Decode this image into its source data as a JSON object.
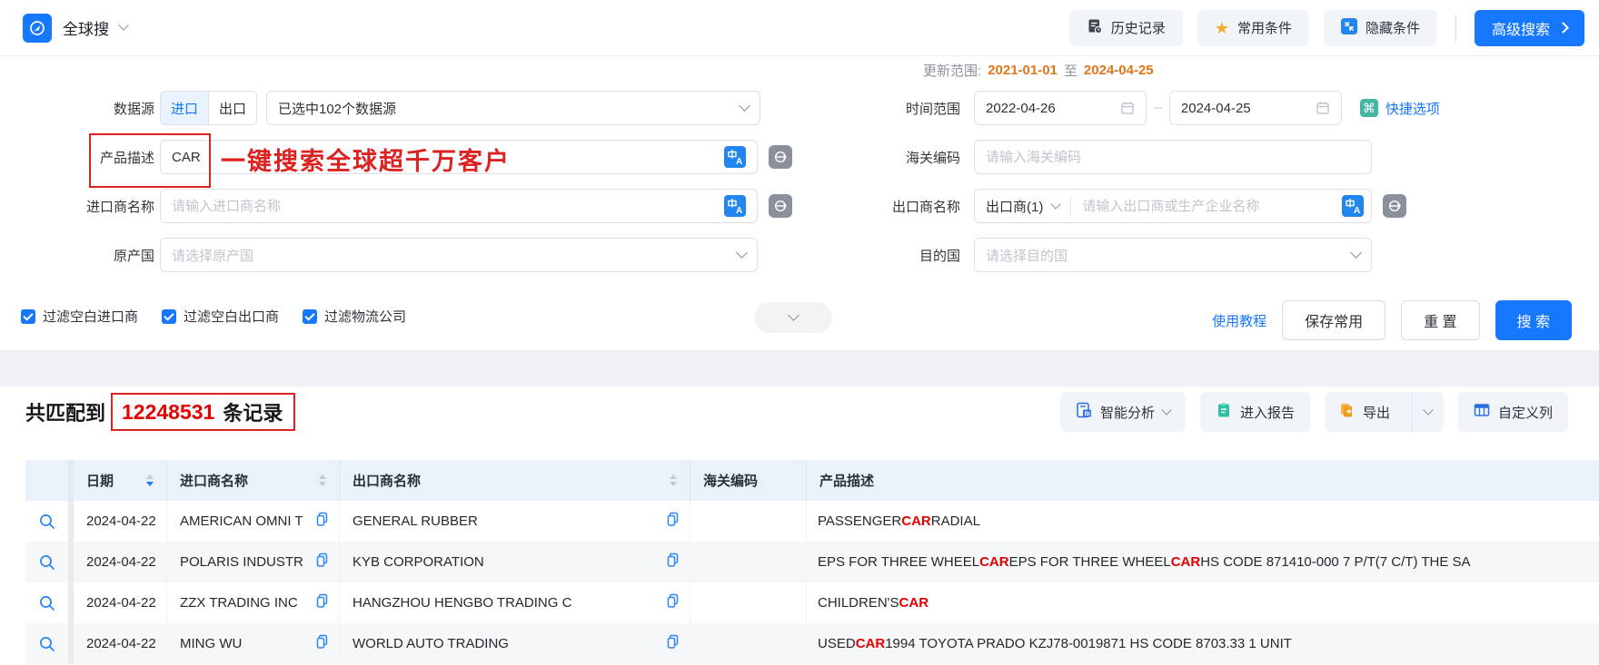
{
  "topbar": {
    "app_title": "全球搜",
    "history_button": "历史记录",
    "favorites_button": "常用条件",
    "hide_conditions_button": "隐藏条件",
    "advanced_search_button": "高级搜索"
  },
  "form": {
    "data_source_label": "数据源",
    "import_option": "进口",
    "export_option": "出口",
    "data_source_selected": "已选中102个数据源",
    "product_desc_label": "产品描述",
    "product_desc_value": "CAR",
    "annotation_text": "一键搜索全球超千万客户",
    "importer_label": "进口商名称",
    "importer_placeholder": "请输入进口商名称",
    "origin_label": "原产国",
    "origin_placeholder": "请选择原产国",
    "update_range_label": "更新范围:",
    "update_range_start": "2021-01-01",
    "update_range_to": "至",
    "update_range_end": "2024-04-25",
    "time_range_label": "时间范围",
    "time_start": "2022-04-26",
    "time_end": "2024-04-25",
    "quick_options_label": "快捷选项",
    "hs_label": "海关编码",
    "hs_placeholder": "请输入海关编码",
    "exporter_label": "出口商名称",
    "exporter_type": "出口商(1)",
    "exporter_placeholder": "请输入出口商或生产企业名称",
    "destination_label": "目的国",
    "destination_placeholder": "请选择目的国",
    "filters": [
      "过滤空白进口商",
      "过滤空白出口商",
      "过滤物流公司"
    ],
    "tutorial_link": "使用教程",
    "save_button": "保存常用",
    "reset_button": "重 置",
    "search_button": "搜 索"
  },
  "results": {
    "matched_prefix": "共匹配到",
    "matched_count": "12248531",
    "matched_suffix": "条记录",
    "analysis_button": "智能分析",
    "report_button": "进入报告",
    "export_button": "导出",
    "custom_columns_button": "自定义列"
  },
  "table": {
    "headers": [
      "日期",
      "进口商名称",
      "出口商名称",
      "海关编码",
      "产品描述"
    ],
    "rows": [
      {
        "date": "2024-04-22",
        "importer": "AMERICAN OMNI T",
        "exporter": "GENERAL RUBBER",
        "hs_code": "",
        "desc": [
          {
            "t": "PASSENGER ",
            "hl": false
          },
          {
            "t": "CAR",
            "hl": true
          },
          {
            "t": " RADIAL",
            "hl": false
          }
        ]
      },
      {
        "date": "2024-04-22",
        "importer": "POLARIS INDUSTR",
        "exporter": "KYB CORPORATION",
        "hs_code": "",
        "desc": [
          {
            "t": "EPS FOR THREE WHEEL ",
            "hl": false
          },
          {
            "t": "CAR",
            "hl": true
          },
          {
            "t": " EPS FOR THREE WHEEL ",
            "hl": false
          },
          {
            "t": "CAR",
            "hl": true
          },
          {
            "t": " HS CODE 871410-000 7 P/T(7 C/T) THE SA",
            "hl": false
          }
        ]
      },
      {
        "date": "2024-04-22",
        "importer": "ZZX TRADING INC",
        "exporter": "HANGZHOU HENGBO TRADING C",
        "hs_code": "",
        "desc": [
          {
            "t": "CHILDREN'S ",
            "hl": false
          },
          {
            "t": "CAR",
            "hl": true
          }
        ]
      },
      {
        "date": "2024-04-22",
        "importer": "MING WU",
        "exporter": "WORLD AUTO TRADING",
        "hs_code": "",
        "desc": [
          {
            "t": "USED ",
            "hl": false
          },
          {
            "t": "CAR",
            "hl": true
          },
          {
            "t": " 1994 TOYOTA PRADO KZJ78-0019871 HS CODE 8703.33 1 UNIT",
            "hl": false
          }
        ]
      }
    ]
  },
  "colors": {
    "primary_blue": "#1677ff",
    "highlight_red": "#e60000",
    "annotation_red": "#dd2222",
    "date_orange": "#e0761a"
  }
}
